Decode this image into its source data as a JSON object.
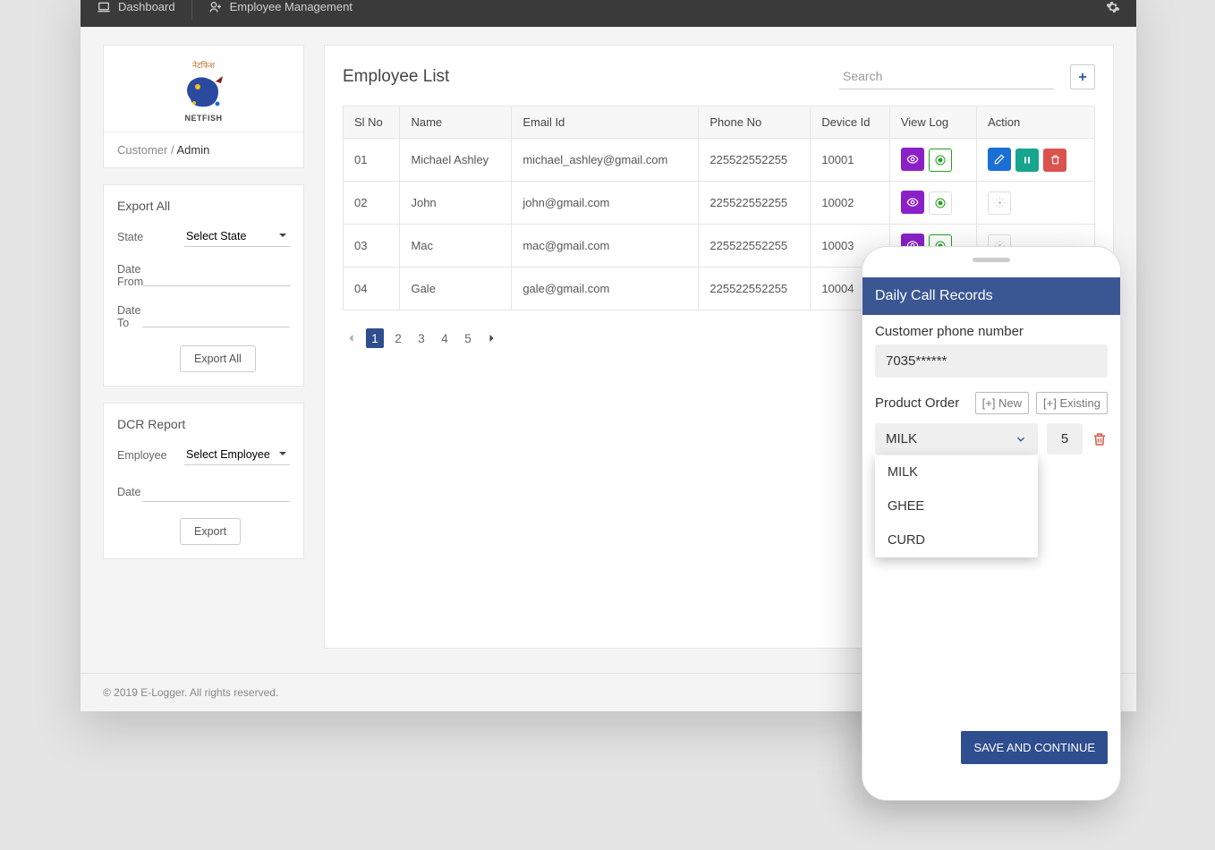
{
  "topbar": {
    "dashboard": "Dashboard",
    "emp_mgmt": "Employee Management"
  },
  "logo": {
    "name": "NETFISH",
    "tagline": "नेटफिश"
  },
  "breadcrumb": {
    "root": "Customer",
    "current": "Admin"
  },
  "export_panel": {
    "title": "Export All",
    "state_label": "State",
    "state_placeholder": "Select State",
    "from_label": "Date From",
    "to_label": "Date To",
    "button": "Export All"
  },
  "dcr_panel": {
    "title": "DCR Report",
    "employee_label": "Employee",
    "employee_placeholder": "Select Employee",
    "date_label": "Date",
    "button": "Export"
  },
  "main": {
    "title": "Employee List",
    "search_placeholder": "Search",
    "columns": [
      "Sl No",
      "Name",
      "Email Id",
      "Phone No",
      "Device Id",
      "View Log",
      "Action"
    ],
    "rows": [
      {
        "sl": "01",
        "name": "Michael Ashley",
        "email": "michael_ashley@gmail.com",
        "phone": "225522552255",
        "device": "10001",
        "dot_active": true,
        "actions_enabled": true
      },
      {
        "sl": "02",
        "name": "John",
        "email": "john@gmail.com",
        "phone": "225522552255",
        "device": "10002",
        "dot_active": false,
        "actions_enabled": false
      },
      {
        "sl": "03",
        "name": "Mac",
        "email": "mac@gmail.com",
        "phone": "225522552255",
        "device": "10003",
        "dot_active": true,
        "actions_enabled": false
      },
      {
        "sl": "04",
        "name": "Gale",
        "email": "gale@gmail.com",
        "phone": "225522552255",
        "device": "10004",
        "dot_active": false,
        "actions_enabled": false
      }
    ],
    "pages": [
      "1",
      "2",
      "3",
      "4",
      "5"
    ],
    "active_page": "1"
  },
  "footer": "© 2019 E-Logger. All rights reserved.",
  "phone": {
    "header": "Daily Call Records",
    "cust_label": "Customer phone number",
    "cust_value": "7035******",
    "prod_label": "Product Order",
    "new_btn": "[+] New",
    "existing_btn": "[+] Existing",
    "selected_product": "MILK",
    "qty": "5",
    "options": [
      "MILK",
      "GHEE",
      "CURD"
    ],
    "save": "SAVE AND CONTINUE"
  }
}
